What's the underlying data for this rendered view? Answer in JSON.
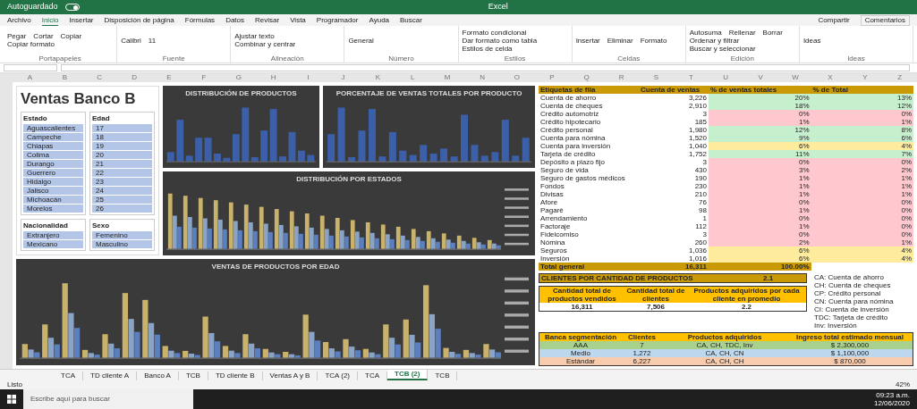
{
  "title_bar": {
    "autosave": "Autoguardado",
    "autosave_on": true,
    "title": "Excel"
  },
  "ribbon_tabs": [
    {
      "label": "Archivo",
      "selected": false
    },
    {
      "label": "Inicio",
      "selected": true
    },
    {
      "label": "Insertar",
      "selected": false
    },
    {
      "label": "Disposición de página",
      "selected": false
    },
    {
      "label": "Fórmulas",
      "selected": false
    },
    {
      "label": "Datos",
      "selected": false
    },
    {
      "label": "Revisar",
      "selected": false
    },
    {
      "label": "Vista",
      "selected": false
    },
    {
      "label": "Programador",
      "selected": false
    },
    {
      "label": "Ayuda",
      "selected": false
    },
    {
      "label": "Buscar",
      "selected": false
    }
  ],
  "share": "Compartir",
  "comments": "Comentarios",
  "ribbon_groups": [
    {
      "label": "Portapapeles",
      "commands": [
        "Pegar",
        "Cortar",
        "Copiar",
        "Copiar formato"
      ]
    },
    {
      "label": "Fuente",
      "commands": [
        "Calibri",
        "11"
      ]
    },
    {
      "label": "Alineación",
      "commands": [
        "Ajustar texto",
        "Combinar y centrar"
      ]
    },
    {
      "label": "Número",
      "commands": [
        "General"
      ]
    },
    {
      "label": "Estilos",
      "commands": [
        "Formato condicional",
        "Dar formato como tabla",
        "Estilos de celda"
      ]
    },
    {
      "label": "Celdas",
      "commands": [
        "Insertar",
        "Eliminar",
        "Formato"
      ]
    },
    {
      "label": "Edición",
      "commands": [
        "Autosuma",
        "Rellenar",
        "Borrar",
        "Ordenar y filtrar",
        "Buscar y seleccionar"
      ]
    },
    {
      "label": "Ideas",
      "commands": [
        "Ideas"
      ]
    }
  ],
  "dashboard": {
    "title": "Ventas Banco B",
    "slicers": [
      {
        "title": "Estado",
        "items": [
          "Aguascalientes",
          "Campeche",
          "Chiapas",
          "Colima",
          "Durango",
          "Guerrero",
          "Hidalgo",
          "Jalisco",
          "Michoacán",
          "Morelos"
        ]
      },
      {
        "title": "Edad",
        "items": [
          "17",
          "18",
          "19",
          "20",
          "21",
          "22",
          "23",
          "24",
          "25",
          "26"
        ]
      },
      {
        "title": "Nacionalidad",
        "items": [
          "Extranjero",
          "Mexicano"
        ]
      },
      {
        "title": "Sexo",
        "items": [
          "Femenino",
          "Masculino"
        ]
      }
    ],
    "charts": [
      {
        "title": "DISTRIBUCIÓN DE PRODUCTOS"
      },
      {
        "title": "PORCENTAJE DE VENTAS TOTALES POR PRODUCTO"
      },
      {
        "title": "DISTRIBUCIÓN POR ESTADOS"
      },
      {
        "title": "VENTAS DE PRODUCTOS POR EDAD"
      }
    ],
    "pivot": {
      "columns": [
        "Etiquetas de fila",
        "Cuenta de ventas",
        "% de ventas totales",
        "% de Total"
      ],
      "rows": [
        {
          "label": "Cuenta de ahorro",
          "value": "3,226",
          "pct": "20%",
          "pct_total": "13%",
          "color": "#c6efce"
        },
        {
          "label": "Cuenta de cheques",
          "value": "2,910",
          "pct": "18%",
          "pct_total": "12%",
          "color": "#c6efce"
        },
        {
          "label": "Crédito automotriz",
          "value": "3",
          "pct": "0%",
          "pct_total": "0%",
          "color": "#ffc7ce"
        },
        {
          "label": "Crédito hipotecario",
          "value": "185",
          "pct": "1%",
          "pct_total": "1%",
          "color": "#ffc7ce"
        },
        {
          "label": "Crédito personal",
          "value": "1,980",
          "pct": "12%",
          "pct_total": "8%",
          "color": "#c6efce"
        },
        {
          "label": "Cuenta para nómina",
          "value": "1,520",
          "pct": "9%",
          "pct_total": "6%",
          "color": "#c6efce"
        },
        {
          "label": "Cuenta para inversión",
          "value": "1,040",
          "pct": "6%",
          "pct_total": "4%",
          "color": "#ffeb9c"
        },
        {
          "label": "Tarjeta de crédito",
          "value": "1,752",
          "pct": "11%",
          "pct_total": "7%",
          "color": "#c6efce"
        },
        {
          "label": "Depósito a plazo fijo",
          "value": "3",
          "pct": "0%",
          "pct_total": "0%",
          "color": "#ffc7ce"
        },
        {
          "label": "Seguro de vida",
          "value": "430",
          "pct": "3%",
          "pct_total": "2%",
          "color": "#ffc7ce"
        },
        {
          "label": "Seguro de gastos médicos",
          "value": "190",
          "pct": "1%",
          "pct_total": "1%",
          "color": "#ffc7ce"
        },
        {
          "label": "Fondos",
          "value": "230",
          "pct": "1%",
          "pct_total": "1%",
          "color": "#ffc7ce"
        },
        {
          "label": "Divisas",
          "value": "210",
          "pct": "1%",
          "pct_total": "1%",
          "color": "#ffc7ce"
        },
        {
          "label": "Afore",
          "value": "76",
          "pct": "0%",
          "pct_total": "0%",
          "color": "#ffc7ce"
        },
        {
          "label": "Pagaré",
          "value": "98",
          "pct": "1%",
          "pct_total": "0%",
          "color": "#ffc7ce"
        },
        {
          "label": "Arrendamiento",
          "value": "1",
          "pct": "0%",
          "pct_total": "0%",
          "color": "#ffc7ce"
        },
        {
          "label": "Factoraje",
          "value": "112",
          "pct": "1%",
          "pct_total": "0%",
          "color": "#ffc7ce"
        },
        {
          "label": "Fideicomiso",
          "value": "3",
          "pct": "0%",
          "pct_total": "0%",
          "color": "#ffc7ce"
        },
        {
          "label": "Nómina",
          "value": "260",
          "pct": "2%",
          "pct_total": "1%",
          "color": "#ffc7ce"
        },
        {
          "label": "Seguros",
          "value": "1,036",
          "pct": "6%",
          "pct_total": "4%",
          "color": "#ffeb9c"
        },
        {
          "label": "Inversión",
          "value": "1,016",
          "pct": "6%",
          "pct_total": "4%",
          "color": "#ffeb9c"
        }
      ],
      "total": {
        "label": "Total general",
        "value": "16,311",
        "pct": "100.00%"
      }
    },
    "summary": {
      "label": "CLIENTES POR CANTIDAD DE PRODUCTOS",
      "value": "2.1"
    },
    "stats": {
      "columns": [
        "Cantidad total de productos vendidos",
        "Cantidad total de clientes",
        "Productos adquiridos por cada cliente en promedio"
      ],
      "values": [
        "16,311",
        "7,506",
        "2.2"
      ]
    },
    "segments": {
      "columns": [
        "Banca segmentación",
        "Clientes",
        "Productos adquiridos",
        "Ingreso total estimado mensual"
      ],
      "rows": [
        {
          "cells": [
            "AAA",
            "7",
            "CA, CH, TDC, Inv",
            "$ 2,300,000"
          ],
          "color": "#a9d18e"
        },
        {
          "cells": [
            "Medio",
            "1,272",
            "CA, CH, CN",
            "$ 1,100,000"
          ],
          "color": "#bdd7ee"
        },
        {
          "cells": [
            "Estándar",
            "6,227",
            "CA, CH, CH",
            "$ 870,000"
          ],
          "color": "#f8cbad"
        }
      ]
    },
    "notes": [
      "CA: Cuenta de ahorro",
      "CH: Cuenta de cheques",
      "CP: Crédito personal",
      "CN: Cuenta para nómina",
      "CI: Cuenta de inversión",
      "TDC: Tarjeta de crédito",
      "Inv: Inversión"
    ]
  },
  "sheet_tabs": [
    {
      "label": "TCA",
      "selected": false
    },
    {
      "label": "TD cliente A",
      "selected": false
    },
    {
      "label": "Banco A",
      "selected": false
    },
    {
      "label": "TCB",
      "selected": false
    },
    {
      "label": "TD cliente B",
      "selected": false
    },
    {
      "label": "Ventas A y B",
      "selected": false
    },
    {
      "label": "TCA (2)",
      "selected": false
    },
    {
      "label": "TCA",
      "selected": false
    },
    {
      "label": "TCB (2)",
      "selected": true
    },
    {
      "label": "TCB",
      "selected": false
    }
  ],
  "column_headers": [
    "A",
    "B",
    "C",
    "D",
    "E",
    "F",
    "G",
    "H",
    "I",
    "J",
    "K",
    "L",
    "M",
    "N",
    "O",
    "P",
    "Q",
    "R",
    "S",
    "T",
    "U",
    "V",
    "W",
    "X",
    "Y",
    "Z"
  ],
  "status": "Listo",
  "zoom": "42%",
  "taskbar": {
    "search_placeholder": "Escribe aquí para buscar",
    "time": "09:23 a.m.",
    "date": "12/06/2020"
  }
}
